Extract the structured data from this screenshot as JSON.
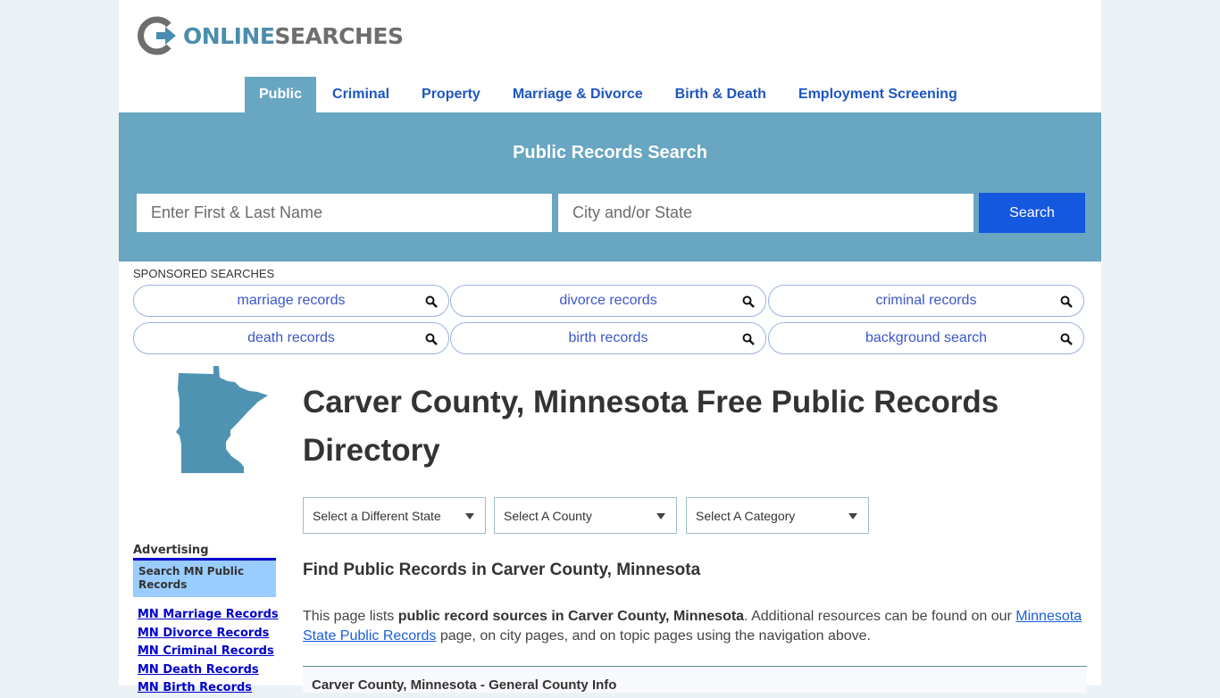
{
  "logo": {
    "part1": "ONLINE",
    "part2": "SEARCHES"
  },
  "nav": {
    "items": [
      {
        "label": "Public",
        "active": true
      },
      {
        "label": "Criminal"
      },
      {
        "label": "Property"
      },
      {
        "label": "Marriage & Divorce"
      },
      {
        "label": "Birth & Death"
      },
      {
        "label": "Employment Screening"
      }
    ]
  },
  "hero": {
    "title": "Public Records Search",
    "name_placeholder": "Enter First & Last Name",
    "name_value": "",
    "location_placeholder": "City and/or State",
    "location_value": "",
    "search_label": "Search"
  },
  "sponsored": {
    "label": "SPONSORED SEARCHES",
    "items": [
      "marriage records",
      "divorce records",
      "criminal records",
      "death records",
      "birth records",
      "background search"
    ]
  },
  "sidebar": {
    "state_icon": "minnesota-map-icon",
    "advertising_label": "Advertising",
    "box_text": "Search MN Public Records",
    "links": [
      "MN Marriage Records",
      "MN Divorce Records",
      "MN Criminal Records",
      "MN Death Records",
      "MN Birth Records"
    ]
  },
  "main": {
    "title": "Carver County, Minnesota Free Public Records Directory",
    "selects": [
      "Select a Different State",
      "Select A County",
      "Select A Category"
    ],
    "subtitle": "Find Public Records in Carver County, Minnesota",
    "intro": {
      "pre": "This page lists ",
      "bold": "public record sources in Carver County, Minnesota",
      "mid": ". Additional resources can be found on our ",
      "link": "Minnesota State Public Records",
      "post": " page, on city pages, and on topic pages using the navigation above."
    },
    "info_heading": "Carver County, Minnesota - General County Info"
  },
  "colors": {
    "accent": "#68a6c1",
    "nav_link": "#1e56c0",
    "search_button": "#1558e0",
    "page_bg": "#ebf2f6"
  }
}
